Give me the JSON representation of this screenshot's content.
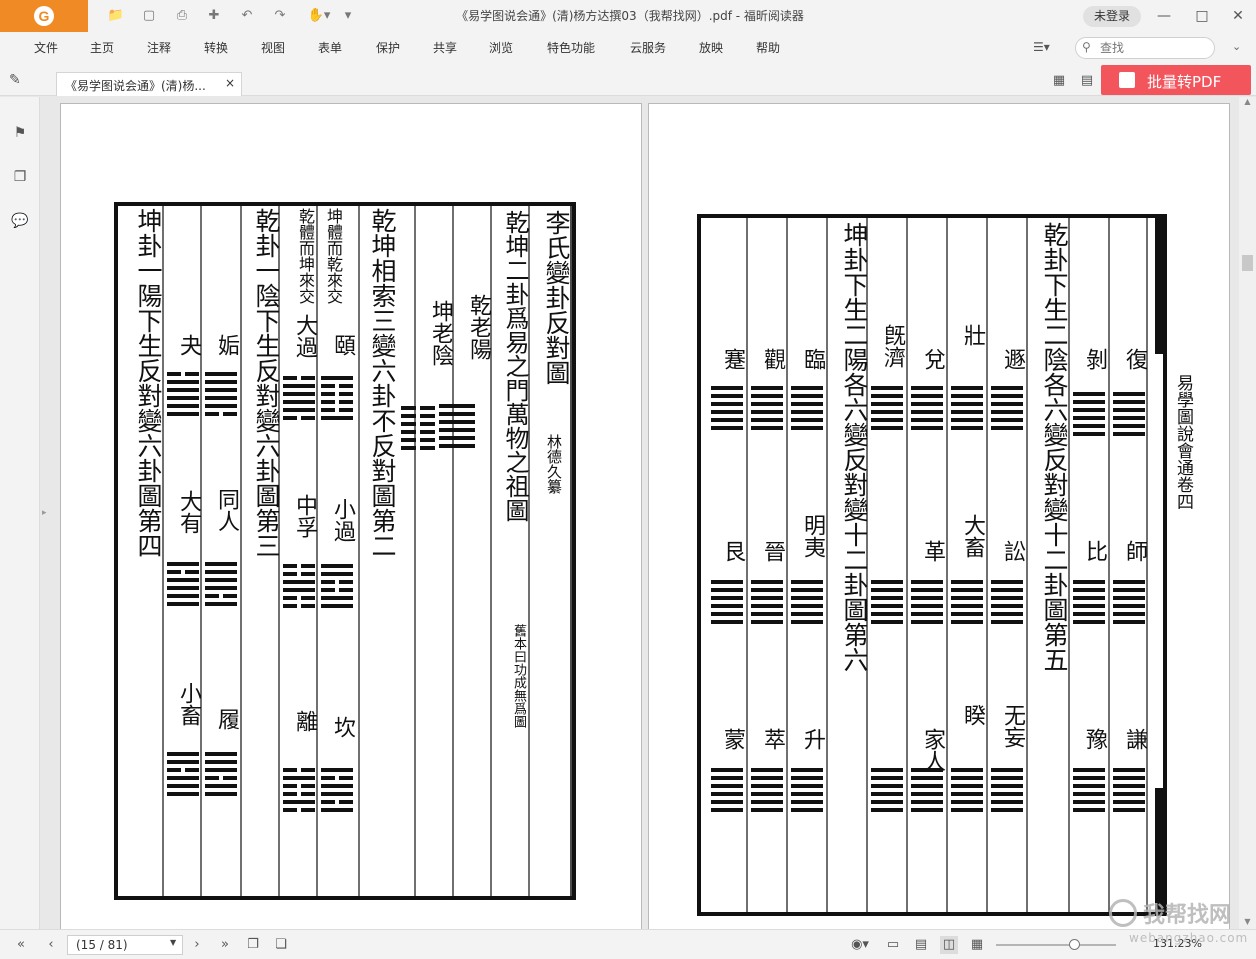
{
  "app": {
    "title": "《易学图说会通》(清)杨方达撰03（我帮找网）.pdf - 福昕阅读器",
    "logo_text": "G",
    "login_label": "未登录"
  },
  "quick_access": [
    "folder-icon",
    "save-icon",
    "print-icon",
    "new-doc-icon",
    "undo-icon",
    "redo-icon",
    "hand-tool-icon",
    "customize-icon"
  ],
  "menu": [
    "文件",
    "主页",
    "注释",
    "转换",
    "视图",
    "表单",
    "保护",
    "共享",
    "浏览",
    "特色功能",
    "云服务",
    "放映",
    "帮助"
  ],
  "search": {
    "placeholder": "查找"
  },
  "tab": {
    "label": "《易学图说会通》(清)杨...",
    "close": "×"
  },
  "batch_button": {
    "label": "批量转PDF"
  },
  "status": {
    "page_value": "(15 / 81)",
    "zoom_value": "131.23%"
  },
  "watermark": {
    "brand": "我帮找网",
    "url": "webangzhao.com"
  },
  "page_left": {
    "columns": [
      "李氏變卦反對圖",
      "林德久纂",
      "乾坤二卦爲易之門萬物之祖圖",
      "舊本曰功成無爲圖",
      "乾老陽",
      "坤老陰",
      "乾坤相索三變六卦不反對圖第二",
      "坤體而乾來交",
      "乾體而坤來交",
      "頤",
      "小過",
      "坎",
      "大過",
      "中孚",
      "離",
      "乾卦一陰下生反對變六卦圖第三",
      "姤",
      "同人",
      "履",
      "夬",
      "大有",
      "小畜",
      "坤卦一陽下生反對變六卦圖第四"
    ]
  },
  "page_right": {
    "columns": [
      "易學圖說會通卷四",
      "復",
      "師",
      "謙",
      "剝",
      "比",
      "豫",
      "乾卦下生二陰各六變反對變十二卦圖第五",
      "遯",
      "訟",
      "无妄",
      "壯",
      "大畜",
      "睽",
      "兌",
      "革",
      "家人",
      "旣濟",
      "坤卦下生二陽各六變反對變十二卦圖第六",
      "臨",
      "明夷",
      "升",
      "觀",
      "晉",
      "萃",
      "蹇",
      "艮",
      "蒙"
    ]
  }
}
